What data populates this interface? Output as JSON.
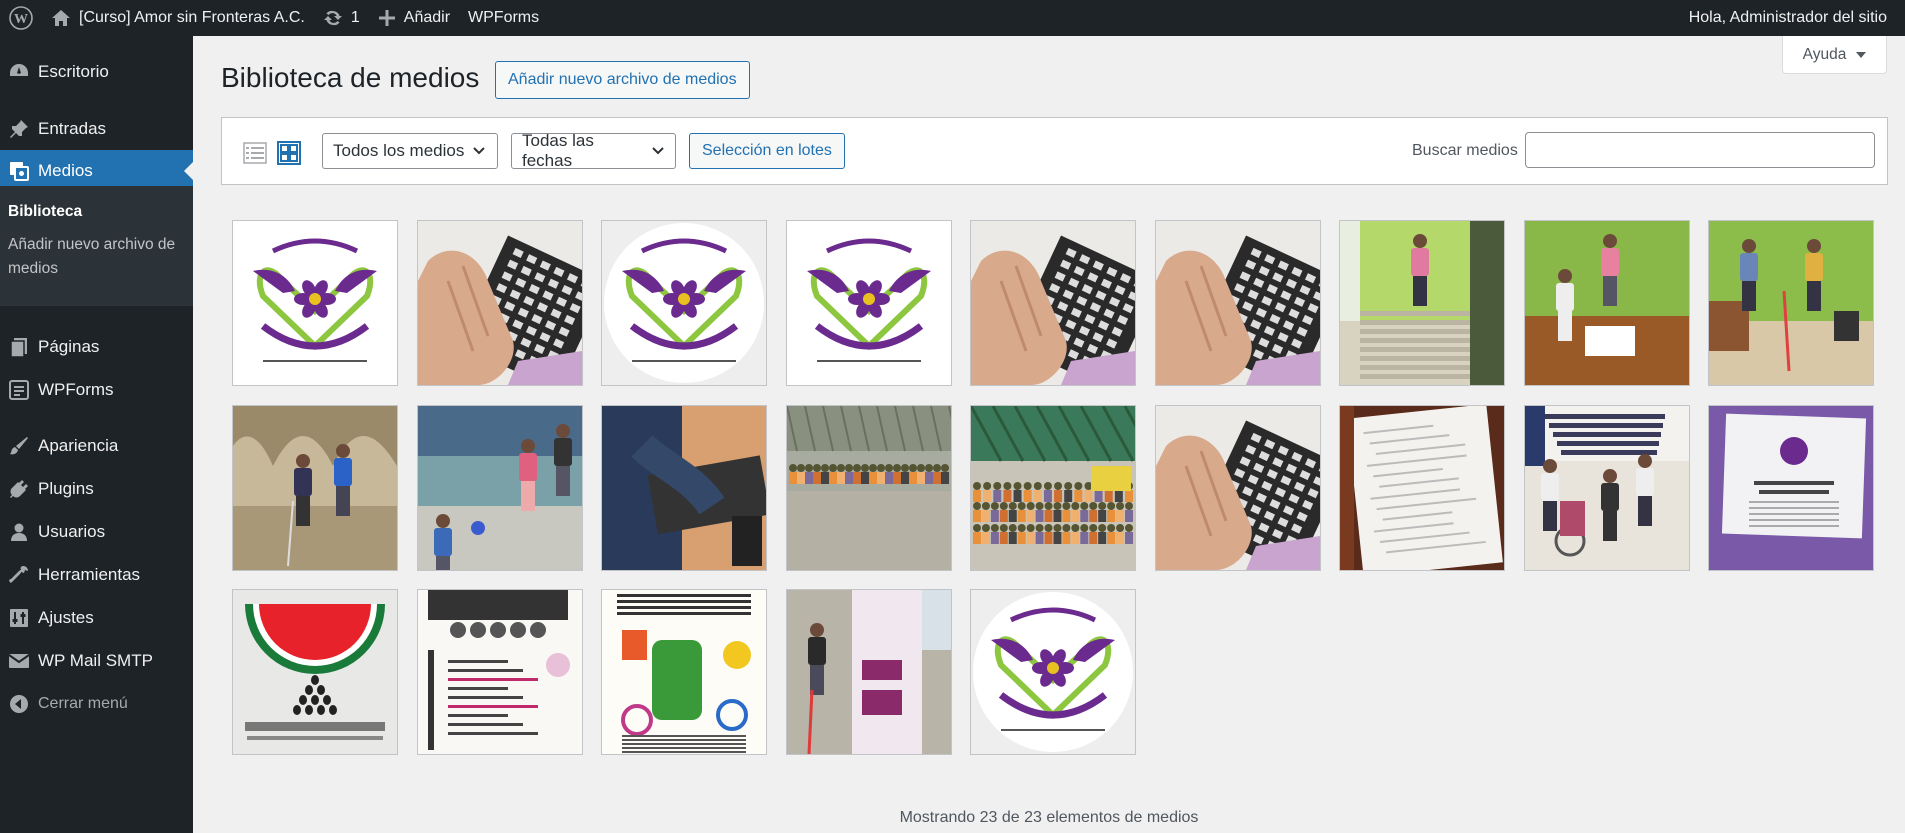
{
  "adminbar": {
    "site_name": "[Curso] Amor sin Fronteras A.C.",
    "updates_count": "1",
    "new_label": "Añadir",
    "wpforms_label": "WPForms",
    "greeting": "Hola, Administrador del sitio"
  },
  "sidebar": {
    "items": [
      {
        "label": "Escritorio",
        "icon": "dashboard-icon"
      },
      {
        "label": "Entradas",
        "icon": "pin-icon"
      },
      {
        "label": "Medios",
        "icon": "media-icon"
      },
      {
        "label": "Páginas",
        "icon": "pages-icon"
      },
      {
        "label": "WPForms",
        "icon": "wpforms-icon"
      },
      {
        "label": "Apariencia",
        "icon": "brush-icon"
      },
      {
        "label": "Plugins",
        "icon": "plug-icon"
      },
      {
        "label": "Usuarios",
        "icon": "users-icon"
      },
      {
        "label": "Herramientas",
        "icon": "wrench-icon"
      },
      {
        "label": "Ajustes",
        "icon": "settings-icon"
      },
      {
        "label": "WP Mail SMTP",
        "icon": "mail-icon"
      },
      {
        "label": "Cerrar menú",
        "icon": "collapse-icon"
      }
    ],
    "submenu": {
      "library": "Biblioteca",
      "add_new": "Añadir nuevo archivo de medios"
    }
  },
  "help_tab": "Ayuda",
  "main": {
    "title": "Biblioteca de medios",
    "add_new_label": "Añadir nuevo archivo de medios"
  },
  "toolbar": {
    "filter_type": "Todos los medios",
    "filter_date": "Todas las fechas",
    "bulk_label": "Selección en lotes",
    "search_label": "Buscar medios",
    "search_value": ""
  },
  "media": [
    {
      "kind": "logo-square"
    },
    {
      "kind": "hand-braille"
    },
    {
      "kind": "logo-circle"
    },
    {
      "kind": "logo-large"
    },
    {
      "kind": "hand-braille"
    },
    {
      "kind": "hand-braille"
    },
    {
      "kind": "stairs-photo"
    },
    {
      "kind": "office-photo"
    },
    {
      "kind": "cane-photo"
    },
    {
      "kind": "arches-photo"
    },
    {
      "kind": "yard-photo"
    },
    {
      "kind": "keyboard-photo"
    },
    {
      "kind": "hall-photo"
    },
    {
      "kind": "crowd-photo"
    },
    {
      "kind": "hand-braille"
    },
    {
      "kind": "braille-page"
    },
    {
      "kind": "banner-photo"
    },
    {
      "kind": "purple-card"
    },
    {
      "kind": "watermelon-logo"
    },
    {
      "kind": "workshop-poster"
    },
    {
      "kind": "party-poster"
    },
    {
      "kind": "woman-photo"
    },
    {
      "kind": "logo-circle"
    }
  ],
  "count_text": "Mostrando 23 de 23 elementos de medios",
  "colors": {
    "admin_bg": "#1d2327",
    "accent": "#2271b1",
    "logo_purple": "#6b2a8e",
    "logo_green": "#8dc63f"
  }
}
